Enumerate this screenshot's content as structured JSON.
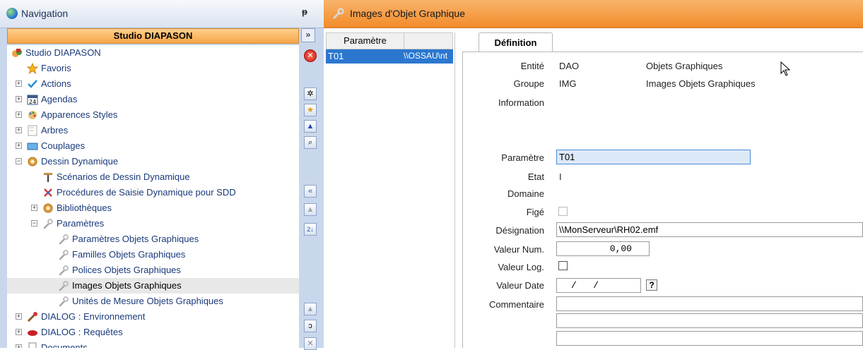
{
  "nav": {
    "title": "Navigation",
    "pin": "ᵽ",
    "studio": "Studio DIAPASON",
    "expand": "»",
    "tree": [
      {
        "label": "Studio DIAPASON",
        "icon": "studio-icon",
        "level": 0,
        "toggle": ""
      },
      {
        "label": "Favoris",
        "icon": "star-icon",
        "level": 1,
        "toggle": ""
      },
      {
        "label": "Actions",
        "icon": "check-icon",
        "level": 1,
        "toggle": "+"
      },
      {
        "label": "Agendas",
        "icon": "calendar-icon",
        "level": 1,
        "toggle": "+"
      },
      {
        "label": "Apparences Styles",
        "icon": "palette-icon",
        "level": 1,
        "toggle": "+"
      },
      {
        "label": "Arbres",
        "icon": "tree-icon",
        "level": 1,
        "toggle": "+"
      },
      {
        "label": "Couplages",
        "icon": "coupling-icon",
        "level": 1,
        "toggle": "+"
      },
      {
        "label": "Dessin Dynamique",
        "icon": "gear-icon",
        "level": 1,
        "toggle": "−"
      },
      {
        "label": "Scénarios de Dessin Dynamique",
        "icon": "scenario-icon",
        "level": 2,
        "toggle": ""
      },
      {
        "label": "Procédures de Saisie Dynamique pour SDD",
        "icon": "procedure-icon",
        "level": 2,
        "toggle": ""
      },
      {
        "label": "Bibliothèques",
        "icon": "gear-icon",
        "level": 2,
        "toggle": "+"
      },
      {
        "label": "Paramètres",
        "icon": "wrench-icon",
        "level": 2,
        "toggle": "−"
      },
      {
        "label": "Paramètres Objets Graphiques",
        "icon": "wrench-icon",
        "level": 3,
        "toggle": ""
      },
      {
        "label": "Familles Objets Graphiques",
        "icon": "wrench-icon",
        "level": 3,
        "toggle": ""
      },
      {
        "label": "Polices Objets Graphiques",
        "icon": "wrench-icon",
        "level": 3,
        "toggle": ""
      },
      {
        "label": "Images Objets Graphiques",
        "icon": "wrench-icon",
        "level": 3,
        "toggle": "",
        "selected": true
      },
      {
        "label": "Unités de Mesure Objets Graphiques",
        "icon": "wrench-icon",
        "level": 3,
        "toggle": ""
      },
      {
        "label": "DIALOG : Environnement",
        "icon": "dialog-env-icon",
        "level": 1,
        "toggle": "+"
      },
      {
        "label": "DIALOG : Requêtes",
        "icon": "dialog-req-icon",
        "level": 1,
        "toggle": "+"
      },
      {
        "label": "Documents",
        "icon": "document-icon",
        "level": 1,
        "toggle": "+"
      }
    ]
  },
  "main": {
    "title": "Images d'Objet Graphique",
    "list": {
      "col_param": "Paramètre",
      "row_param": "T01",
      "row_value": "\\\\OSSAU\\nt"
    },
    "tab_definition": "Définition",
    "form": {
      "entite_label": "Entité",
      "entite_code": "DAO",
      "entite_desc": "Objets Graphiques",
      "groupe_label": "Groupe",
      "groupe_code": "IMG",
      "groupe_desc": "Images Objets Graphiques",
      "information_label": "Information",
      "parametre_label": "Paramètre",
      "parametre_value": "T01",
      "etat_label": "Etat",
      "etat_value": "I",
      "domaine_label": "Domaine",
      "fige_label": "Figé",
      "designation_label": "Désignation",
      "designation_value": "\\\\MonServeur\\RH02.emf",
      "valeur_num_label": "Valeur Num.",
      "valeur_num_value": "0,00",
      "valeur_log_label": "Valeur Log.",
      "valeur_date_label": "Valeur Date",
      "valeur_date_value": "/   /",
      "date_help": "?",
      "commentaire_label": "Commentaire"
    }
  },
  "colors": {
    "nav_bg": "#c9d7ec",
    "studio_bar": "#f6a64a",
    "header_orange": "#f28b2a",
    "selection_blue": "#2b77d0"
  }
}
